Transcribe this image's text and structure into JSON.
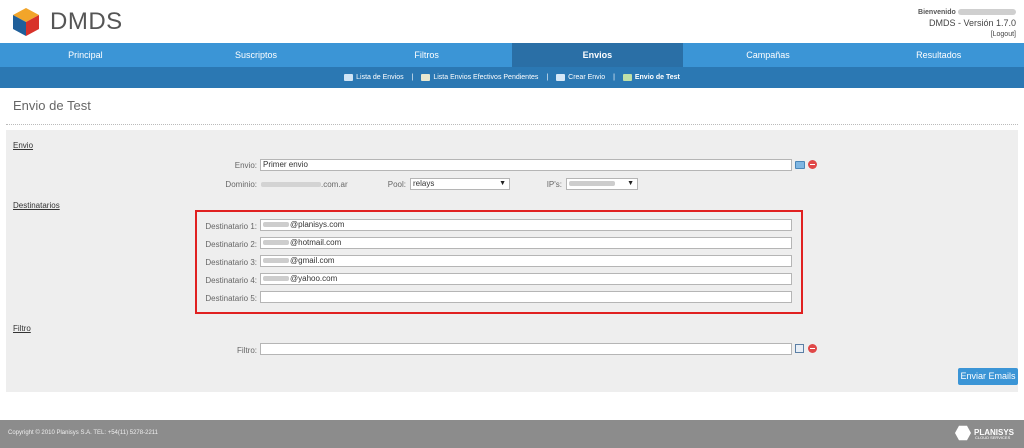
{
  "header": {
    "logo_text": "DMDS",
    "welcome": "Bienvenido",
    "version": "DMDS - Versión 1.7.0",
    "logout": "[Logout]"
  },
  "nav": [
    {
      "label": "Principal"
    },
    {
      "label": "Suscriptos"
    },
    {
      "label": "Filtros"
    },
    {
      "label": "Envios"
    },
    {
      "label": "Campañas"
    },
    {
      "label": "Resultados"
    }
  ],
  "subnav": [
    {
      "label": "Lista de Envios"
    },
    {
      "label": "Lista Envios Efectivos Pendientes"
    },
    {
      "label": "Crear Envio"
    },
    {
      "label": "Envio de Test"
    }
  ],
  "page": {
    "title": "Envio de Test"
  },
  "form": {
    "section_envio": "Envio",
    "envio_label": "Envio:",
    "envio_value": "Primer envio",
    "dominio_label": "Dominio:",
    "dominio_suffix": ".com.ar",
    "pool_label": "Pool:",
    "pool_value": "relays",
    "ips_label": "IP's:",
    "section_destinatarios": "Destinatarios",
    "destinatarios": [
      {
        "label": "Destinatario 1:",
        "domain": "@planisys.com"
      },
      {
        "label": "Destinatario 2:",
        "domain": "@hotmail.com"
      },
      {
        "label": "Destinatario 3:",
        "domain": "@gmail.com"
      },
      {
        "label": "Destinatario 4:",
        "domain": "@yahoo.com"
      },
      {
        "label": "Destinatario 5:",
        "domain": ""
      }
    ],
    "section_filtro": "Filtro",
    "filtro_label": "Filtro:",
    "submit_label": "Enviar Emails"
  },
  "footer": {
    "copyright": "Copyright © 2010 Planisys S.A. TEL: +54(11) 5278-2211",
    "brand": "PLANISYS",
    "brand_sub": "CLOUD SERVICES"
  },
  "colors": {
    "nav_bg": "#3b95d6",
    "nav_active": "#2a6fa6",
    "subnav_bg": "#2b78b3",
    "highlight_border": "#e02020",
    "footer_bg": "#8c8c8c"
  }
}
